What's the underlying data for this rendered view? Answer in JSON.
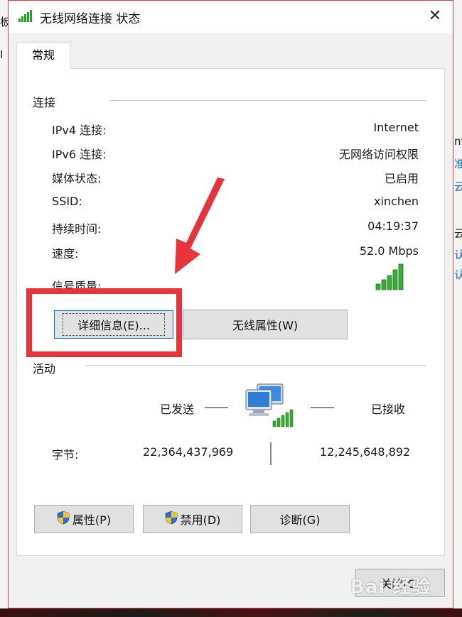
{
  "background": {
    "left_fragments": [
      "板",
      "I"
    ],
    "right_fragments": [
      "nf",
      "准",
      "云",
      "云",
      "认",
      "认"
    ]
  },
  "dialog": {
    "title": "无线网络连接 状态",
    "close_symbol": "✕",
    "tab_label": "常规"
  },
  "connection": {
    "group_title": "连接",
    "rows": [
      {
        "label": "IPv4 连接:",
        "value": "Internet"
      },
      {
        "label": "IPv6 连接:",
        "value": "无网络访问权限"
      },
      {
        "label": "媒体状态:",
        "value": "已启用"
      },
      {
        "label": "SSID:",
        "value": "xinchen"
      },
      {
        "label": "持续时间:",
        "value": "04:19:37"
      },
      {
        "label": "速度:",
        "value": "52.0 Mbps"
      }
    ],
    "signal_label": "信号质量:",
    "signal_bars": 5,
    "details_button": "详细信息(E)...",
    "wireless_props_button": "无线属性(W)"
  },
  "activity": {
    "group_title": "活动",
    "sent_label": "已发送",
    "received_label": "已接收",
    "bytes_label": "字节:",
    "bytes_sent": "22,364,437,969",
    "bytes_received": "12,245,648,892"
  },
  "buttons": {
    "properties": "属性(P)",
    "disable": "禁用(D)",
    "diagnose": "诊断(G)",
    "close": "关闭(C)"
  },
  "watermark": "Bai 经验",
  "colors": {
    "annotation_red": "#e8333a",
    "signal_green": "#2e9e2e",
    "focus_blue": "#0078d7"
  }
}
